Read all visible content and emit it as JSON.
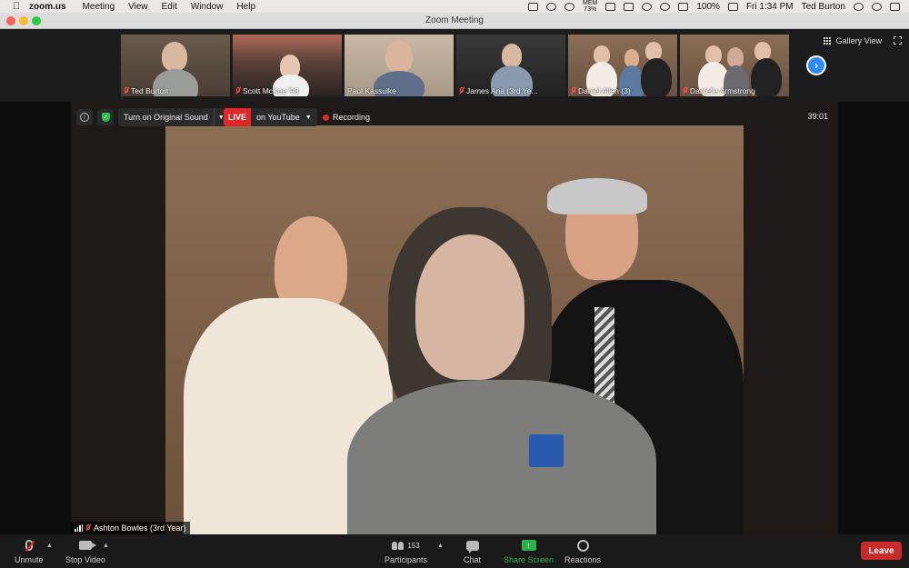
{
  "menubar": {
    "app": "zoom.us",
    "menus": [
      "Meeting",
      "View",
      "Edit",
      "Window",
      "Help"
    ],
    "mem_label": "MEM",
    "mem_value": "73%",
    "battery": "100%",
    "clock": "Fri 1:34 PM",
    "user": "Ted Burton"
  },
  "window": {
    "title": "Zoom Meeting"
  },
  "gallery": {
    "view_label": "Gallery View",
    "tiles": [
      {
        "name": "Ted Burton"
      },
      {
        "name": "Scott McKee '98"
      },
      {
        "name": "Paul Kassulke"
      },
      {
        "name": "James Ana (3rd Ye..."
      },
      {
        "name": "Daniel Allen (3)"
      },
      {
        "name": "Danielle Armstrong"
      }
    ]
  },
  "meeting": {
    "original_sound": "Turn on Original Sound",
    "live_badge": "LIVE",
    "live_target": "on YouTube",
    "recording": "Recording",
    "timer": "39:01",
    "active_speaker": "Ashton Bowles (3rd Year)"
  },
  "toolbar": {
    "unmute": "Unmute",
    "stop_video": "Stop Video",
    "participants": "Participants",
    "participant_count": "153",
    "chat": "Chat",
    "share_screen": "Share Screen",
    "reactions": "Reactions",
    "leave": "Leave"
  },
  "colors": {
    "live_red": "#e02828",
    "share_green": "#28b44a",
    "leave_red": "#c92b2b",
    "zoom_blue": "#2d8cff"
  }
}
